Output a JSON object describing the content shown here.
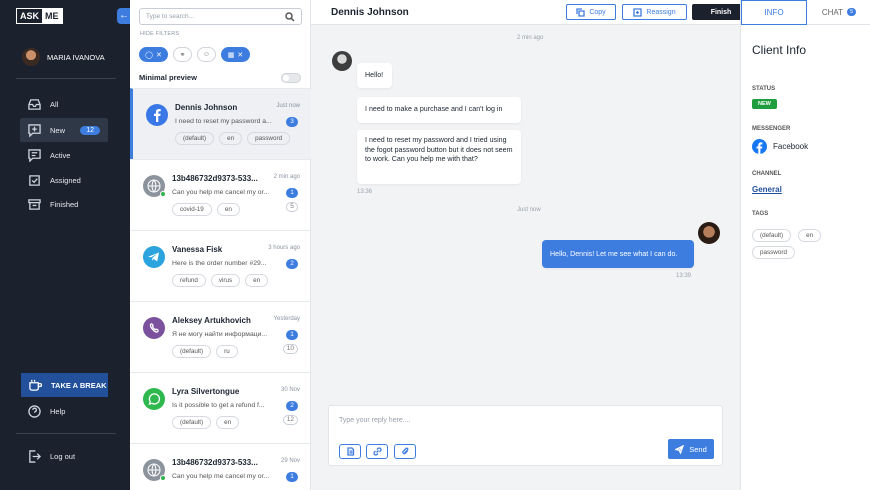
{
  "app": {
    "logo_left": "ASK",
    "logo_right": "ME"
  },
  "user": {
    "name": "MARIA IVANOVA"
  },
  "nav": {
    "items": [
      {
        "label": "All"
      },
      {
        "label": "New",
        "count": "12"
      },
      {
        "label": "Active"
      },
      {
        "label": "Assigned"
      },
      {
        "label": "Finished"
      }
    ],
    "break_label": "TAKE A BREAK",
    "help_label": "Help",
    "logout_label": "Log out"
  },
  "list": {
    "search_placeholder": "Type to search...",
    "hide_filters": "HIDE FILTERS",
    "minimal_preview": "Minimal preview",
    "conversations": [
      {
        "name": "Dennis Johnson",
        "time": "Just now",
        "preview": "I need to reset my password a...",
        "count": "3",
        "tags": [
          "(default)",
          "en",
          "password"
        ],
        "channel": "facebook"
      },
      {
        "name": "13b486732d9373-533...",
        "time": "2 min ago",
        "preview": "Can you help me cancel my or...",
        "count": "1",
        "count2": "5",
        "tags": [
          "covid-19",
          "en"
        ],
        "channel": "web"
      },
      {
        "name": "Vanessa Fisk",
        "time": "3 hours ago",
        "preview": "Here is the order number #29...",
        "count": "2",
        "tags": [
          "refund",
          "virus",
          "en"
        ],
        "channel": "telegram"
      },
      {
        "name": "Aleksey Artukhovich",
        "time": "Yesterday",
        "preview": "Я не могу найти информаци...",
        "count": "1",
        "count2": "10",
        "tags": [
          "(default)",
          "ru"
        ],
        "channel": "viber"
      },
      {
        "name": "Lyra Silvertongue",
        "time": "30 Nov",
        "preview": "Is it possible to get a refund f...",
        "count": "2",
        "count2": "12",
        "tags": [
          "(default)",
          "en"
        ],
        "channel": "whatsapp"
      },
      {
        "name": "13b486732d9373-533...",
        "time": "29 Nov",
        "preview": "Can you help me cancel my or...",
        "count": "1",
        "tags": [],
        "channel": "web"
      }
    ]
  },
  "chat": {
    "contact": "Dennis Johnson",
    "copy_label": "Copy",
    "reassign_label": "Reassign",
    "finish_label": "Finish",
    "time_top": "2 min ago",
    "time_mid": "Just now",
    "messages_in": [
      "Hello!",
      "I need to make a purchase and I can't log in",
      "I need to reset my password and I tried using the fogot password button but it does not seem to work. Can you help me with that?"
    ],
    "time_in": "13:36",
    "message_out": "Hello, Dennis! Let me see what I can do.",
    "time_out": "13:39",
    "reply_placeholder": "Type your reply here....",
    "send_label": "Send"
  },
  "info": {
    "tab_info": "INFO",
    "tab_chat": "CHAT",
    "chat_count": "5",
    "title": "Client Info",
    "status_label": "STATUS",
    "status": "NEW",
    "messenger_label": "MESSENGER",
    "messenger": "Facebook",
    "channel_label": "CHANNEL",
    "channel": "General",
    "tags_label": "TAGS",
    "tags": [
      "(default)",
      "en",
      "password"
    ]
  },
  "colors": {
    "accent": "#3d7de0",
    "sidebar": "#1c222d",
    "status_new": "#1f9d3f"
  }
}
